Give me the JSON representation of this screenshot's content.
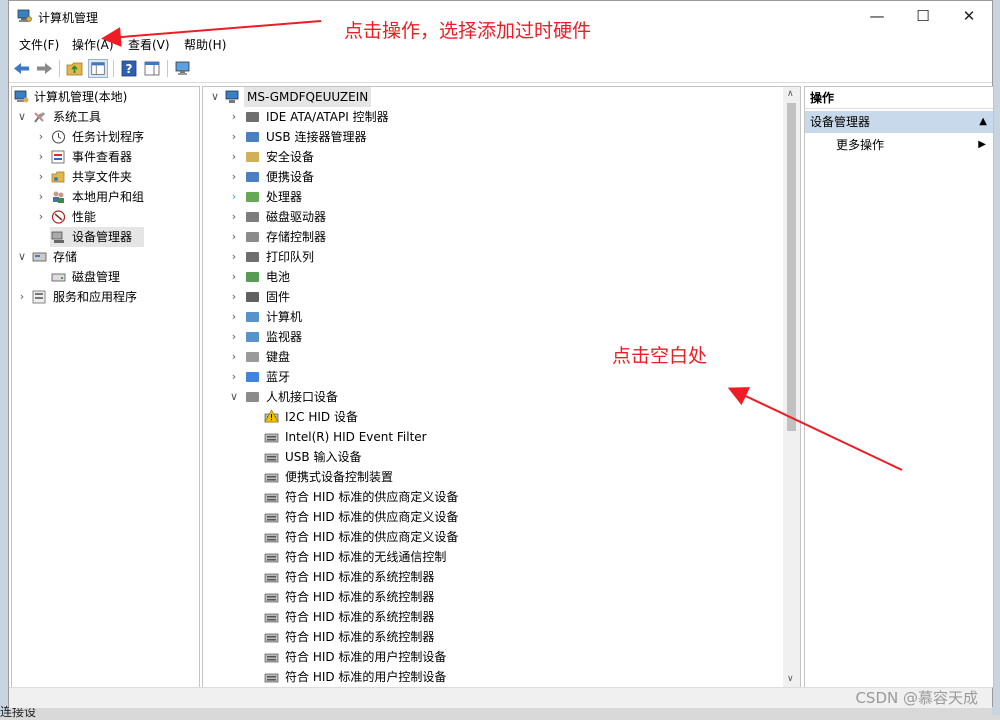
{
  "window": {
    "title": "计算机管理"
  },
  "menu": {
    "file": "文件(F)",
    "action": "操作(A)",
    "view": "查看(V)",
    "help": "帮助(H)"
  },
  "left_tree": [
    {
      "label": "计算机管理(本地)",
      "icon": "computer-management-icon"
    },
    {
      "label": "系统工具",
      "icon": "tools-icon"
    },
    {
      "label": "任务计划程序",
      "icon": "clock-icon"
    },
    {
      "label": "事件查看器",
      "icon": "event-viewer-icon"
    },
    {
      "label": "共享文件夹",
      "icon": "shared-folder-icon"
    },
    {
      "label": "本地用户和组",
      "icon": "users-icon"
    },
    {
      "label": "性能",
      "icon": "performance-icon"
    },
    {
      "label": "设备管理器",
      "icon": "device-manager-icon"
    },
    {
      "label": "存储",
      "icon": "storage-icon"
    },
    {
      "label": "磁盘管理",
      "icon": "disk-icon"
    },
    {
      "label": "服务和应用程序",
      "icon": "services-icon"
    }
  ],
  "device_root": "MS-GMDFQEUUZEIN",
  "device_categories": [
    {
      "label": "IDE ATA/ATAPI 控制器",
      "icon": "ide-controller-icon"
    },
    {
      "label": "USB 连接器管理器",
      "icon": "usb-icon"
    },
    {
      "label": "安全设备",
      "icon": "security-icon"
    },
    {
      "label": "便携设备",
      "icon": "portable-device-icon"
    },
    {
      "label": "处理器",
      "icon": "processor-icon"
    },
    {
      "label": "磁盘驱动器",
      "icon": "disk-drive-icon"
    },
    {
      "label": "存储控制器",
      "icon": "storage-controller-icon"
    },
    {
      "label": "打印队列",
      "icon": "printer-icon"
    },
    {
      "label": "电池",
      "icon": "battery-icon"
    },
    {
      "label": "固件",
      "icon": "firmware-icon"
    },
    {
      "label": "计算机",
      "icon": "computer-icon"
    },
    {
      "label": "监视器",
      "icon": "monitor-icon"
    },
    {
      "label": "键盘",
      "icon": "keyboard-icon"
    },
    {
      "label": "蓝牙",
      "icon": "bluetooth-icon"
    },
    {
      "label": "人机接口设备",
      "icon": "hid-icon"
    }
  ],
  "hid_devices": [
    {
      "label": "I2C HID 设备",
      "warning": true
    },
    {
      "label": "Intel(R) HID Event Filter",
      "warning": false
    },
    {
      "label": "USB 输入设备",
      "warning": false
    },
    {
      "label": "便携式设备控制装置",
      "warning": false
    },
    {
      "label": "符合 HID 标准的供应商定义设备",
      "warning": false
    },
    {
      "label": "符合 HID 标准的供应商定义设备",
      "warning": false
    },
    {
      "label": "符合 HID 标准的供应商定义设备",
      "warning": false
    },
    {
      "label": "符合 HID 标准的无线通信控制",
      "warning": false
    },
    {
      "label": "符合 HID 标准的系统控制器",
      "warning": false
    },
    {
      "label": "符合 HID 标准的系统控制器",
      "warning": false
    },
    {
      "label": "符合 HID 标准的系统控制器",
      "warning": false
    },
    {
      "label": "符合 HID 标准的系统控制器",
      "warning": false
    },
    {
      "label": "符合 HID 标准的用户控制设备",
      "warning": false
    },
    {
      "label": "符合 HID 标准的用户控制设备",
      "warning": false
    }
  ],
  "actions": {
    "header": "操作",
    "section": "设备管理器",
    "more": "更多操作"
  },
  "annotations": {
    "top": "点击操作，选择添加过时硬件",
    "middle": "点击空白处"
  },
  "watermark": "CSDN @慕容天成",
  "background": {
    "bottom_text": "连接设"
  },
  "colors": {
    "annotation": "#ee1c25",
    "selection": "#e5e5e5",
    "action_section": "#c7d9ea"
  }
}
